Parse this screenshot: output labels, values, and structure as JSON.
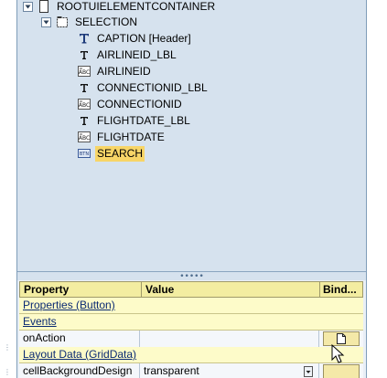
{
  "tree": {
    "nodes": [
      {
        "label": "ROOTUIELEMENTCONTAINER",
        "icon": "container-icon",
        "expanded": true
      },
      {
        "label": "SELECTION",
        "icon": "group-icon",
        "expanded": true
      },
      {
        "label": "CAPTION  [Header]",
        "icon": "text-view-icon"
      },
      {
        "label": "AIRLINEID_LBL",
        "icon": "label-icon"
      },
      {
        "label": "AIRLINEID",
        "icon": "input-field-icon"
      },
      {
        "label": "CONNECTIONID_LBL",
        "icon": "label-icon"
      },
      {
        "label": "CONNECTIONID",
        "icon": "input-field-icon"
      },
      {
        "label": "FLIGHTDATE_LBL",
        "icon": "label-icon"
      },
      {
        "label": "FLIGHTDATE",
        "icon": "input-field-icon"
      },
      {
        "label": "SEARCH",
        "icon": "button-icon",
        "selected": true
      }
    ]
  },
  "properties": {
    "headers": {
      "property": "Property",
      "value": "Value",
      "binding": "Bind..."
    },
    "rows": [
      {
        "type": "section",
        "label": "Properties (Button)"
      },
      {
        "type": "section",
        "label": "Events"
      },
      {
        "type": "data",
        "property": "onAction",
        "value": ""
      },
      {
        "type": "section",
        "label": "Layout Data (GridData)"
      },
      {
        "type": "data",
        "property": "cellBackgroundDesign",
        "value": "transparent"
      }
    ]
  },
  "colors": {
    "tree_background": "#d6e2ee",
    "selection": "#f7d567",
    "header": "#f3eda1",
    "section_row": "#fdfbc9"
  }
}
